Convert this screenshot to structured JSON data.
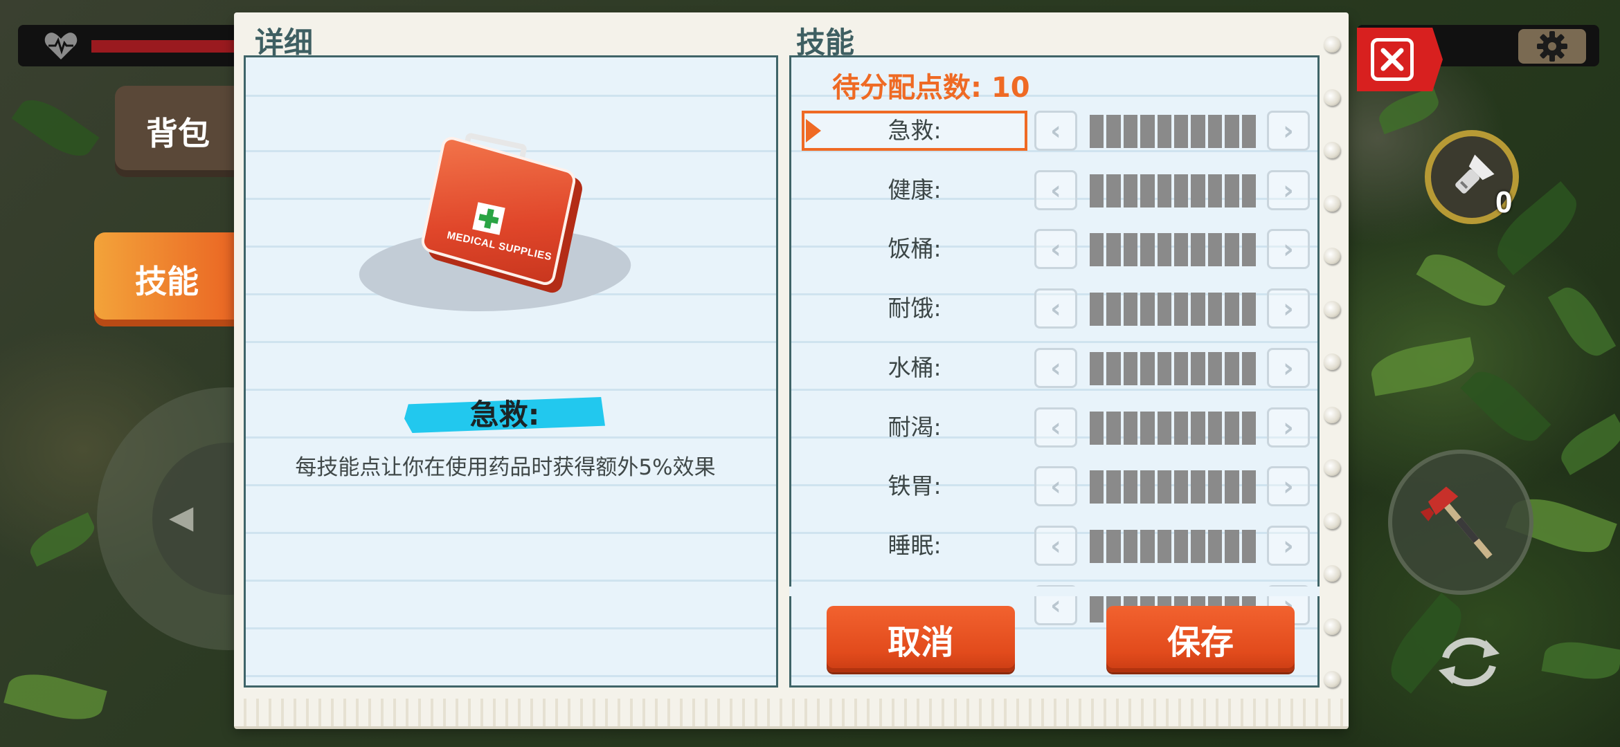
{
  "tabs": {
    "bag": "背包",
    "skills": "技能"
  },
  "details": {
    "title": "详细",
    "item_label": "MEDICAL SUPPLIES",
    "skill_name": "急救:",
    "description": "每技能点让你在使用药品时获得额外5%效果"
  },
  "skills": {
    "title": "技能",
    "points_label": "待分配点数:",
    "points_value": "10",
    "selected_index": 0,
    "rows": [
      {
        "label": "急救:",
        "level": 0,
        "max": 10
      },
      {
        "label": "健康:",
        "level": 0,
        "max": 10
      },
      {
        "label": "饭桶:",
        "level": 0,
        "max": 10
      },
      {
        "label": "耐饿:",
        "level": 0,
        "max": 10
      },
      {
        "label": "水桶:",
        "level": 0,
        "max": 10
      },
      {
        "label": "耐渴:",
        "level": 0,
        "max": 10
      },
      {
        "label": "铁胃:",
        "level": 0,
        "max": 10
      },
      {
        "label": "睡眠:",
        "level": 0,
        "max": 10
      }
    ],
    "cancel": "取消",
    "save": "保存"
  },
  "hud": {
    "torch_count": "0",
    "health_fraction": 0.42
  },
  "icons": {
    "decrease": "chevron-left-icon",
    "increase": "chevron-right-icon",
    "close": "close-icon",
    "settings": "gear-icon",
    "health": "heart-icon",
    "torch": "flashlight-icon",
    "weapon": "axe-icon",
    "reload": "reload-icon"
  },
  "colors": {
    "accent": "#ef6a24",
    "button": "#e24b1c",
    "panel_border": "#3f6468",
    "banner": "#22c8ee",
    "bar_empty": "#8a8a8a",
    "close": "#d8201f"
  }
}
